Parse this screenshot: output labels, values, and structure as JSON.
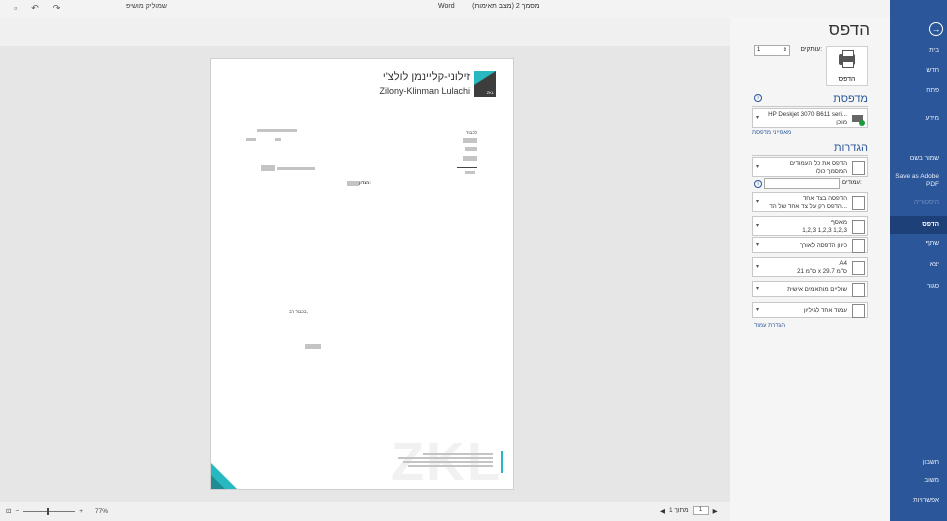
{
  "titlebar": {
    "save_icon": "save-icon",
    "undo_icon": "undo-icon",
    "redo_icon": "redo-icon",
    "user_name": "שמוליק מושיפ",
    "app_name": "Word",
    "doc_title": "מסמך 2 (מצב תאימות)"
  },
  "nav": {
    "back_icon": "back-arrow-icon",
    "items": [
      {
        "label": "בית"
      },
      {
        "label": "חדש"
      },
      {
        "label": "פתח"
      },
      {
        "label": "מידע"
      },
      {
        "label": "שמור בשם"
      },
      {
        "label": "Save as Adobe PDF"
      },
      {
        "label": "היסטוריה"
      },
      {
        "label": "הדפס"
      },
      {
        "label": "שתף"
      },
      {
        "label": "יצא"
      },
      {
        "label": "סגור"
      },
      {
        "label": "חשבון"
      },
      {
        "label": "משוב"
      },
      {
        "label": "אפשרויות"
      }
    ]
  },
  "print": {
    "title": "הדפס",
    "print_button": "הדפס",
    "copies_label": "עותקים:",
    "copies_value": "1",
    "printer_section": "מדפסת",
    "printer_name": "HP Deskjet 3070 B611 seri...",
    "printer_status": "מוכן",
    "printer_properties": "מאפייני מדפסת",
    "settings_section": "הגדרות",
    "settings": [
      {
        "line1": "הדפס את כל העמודים",
        "line2": "המסמך כולו"
      },
      {
        "line1": "הדפסה בצד אחד",
        "line2": "הדפס רק על צד אחד של הד..."
      },
      {
        "line1": "מאסף",
        "line2": "1,2,3 1,2,3 1,2,3"
      },
      {
        "line1": "כיוון הדפסה לאורך",
        "line2": ""
      },
      {
        "line1": "A4",
        "line2": "21 ס\"מ x 29.7 ס\"מ"
      },
      {
        "line1": "שוליים מותאמים אישית",
        "line2": ""
      },
      {
        "line1": "עמוד אחד לגיליון",
        "line2": ""
      }
    ],
    "pages_label": "עמודים:",
    "page_setup_link": "הגדרת עמוד"
  },
  "document": {
    "logo_hebrew": "זילוני-קליינמן לולצ'י",
    "logo_english": "Zilony-Klinman Lulachi",
    "logo_mark_text": "ZKL",
    "to_label": "לכבוד",
    "re_label": "הנדון:",
    "regards": "בכבוד רב,",
    "signature": "עו\"ד",
    "watermark": "ZKL"
  },
  "pagenav": {
    "current": "1",
    "of_text": "מתוך 1"
  },
  "status": {
    "zoom_level": "77%"
  }
}
